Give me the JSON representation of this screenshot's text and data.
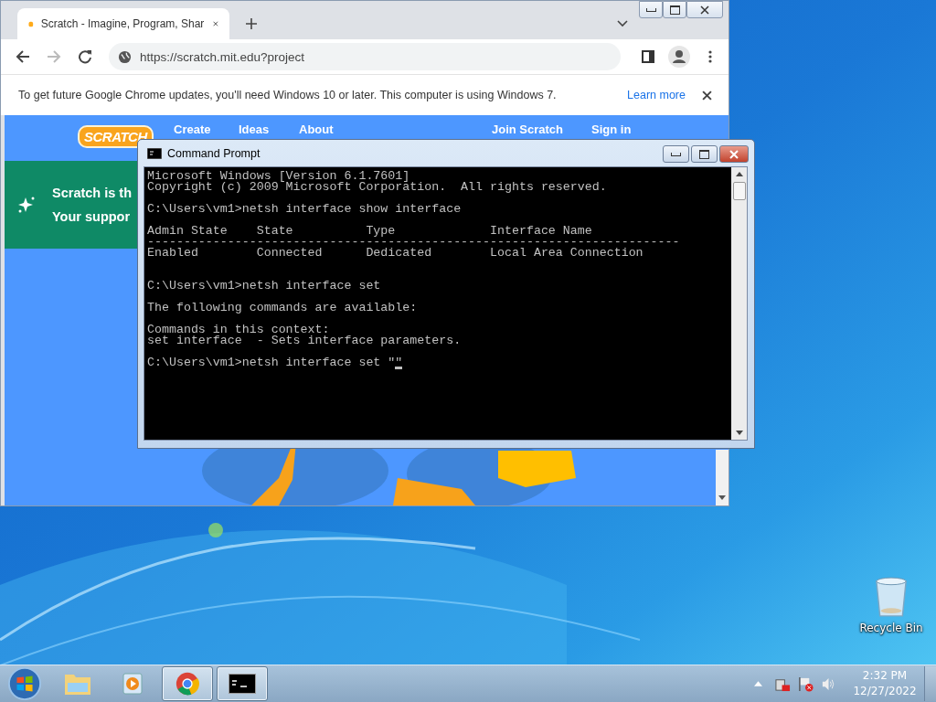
{
  "desktop": {
    "icons": [
      {
        "label": "Recycle Bin"
      }
    ]
  },
  "browser": {
    "tab": {
      "title": "Scratch - Imagine, Program, Shar"
    },
    "url": "https://scratch.mit.edu?project",
    "infobar": {
      "message": "To get future Google Chrome updates, you'll need Windows 10 or later. This computer is using Windows 7.",
      "link": "Learn more"
    },
    "page": {
      "logo": "SCRATCH",
      "nav": [
        {
          "label": "Create"
        },
        {
          "label": "Ideas"
        },
        {
          "label": "About"
        },
        {
          "label": "Join Scratch"
        },
        {
          "label": "Sign in"
        }
      ],
      "banner": [
        "Scratch is th",
        "Your suppor"
      ]
    }
  },
  "console": {
    "title": "Command Prompt",
    "blocks": [
      {
        "kind": "output",
        "lines": [
          "Microsoft Windows [Version 6.1.7601]",
          "Copyright (c) 2009 Microsoft Corporation.  All rights reserved."
        ]
      },
      {
        "kind": "output",
        "lines": [
          "C:\\Users\\vm1>netsh interface show interface"
        ]
      },
      {
        "kind": "table",
        "lines": [
          "Admin State    State          Type             Interface Name",
          "-------------------------------------------------------------------------",
          "Enabled        Connected      Dedicated        Local Area Connection"
        ]
      },
      {
        "kind": "output",
        "lines": [
          "C:\\Users\\vm1>netsh interface set"
        ]
      },
      {
        "kind": "output",
        "lines": [
          "The following commands are available:"
        ]
      },
      {
        "kind": "output",
        "lines": [
          "Commands in this context:",
          "set interface  - Sets interface parameters."
        ]
      },
      {
        "kind": "prompt",
        "lines": [
          "C:\\Users\\vm1>netsh interface set \"\""
        ]
      }
    ]
  },
  "taskbar": {
    "items": [
      {
        "kind": "explorer",
        "running": false
      },
      {
        "kind": "media",
        "running": false
      },
      {
        "kind": "chrome",
        "running": true
      },
      {
        "kind": "console",
        "running": true
      }
    ],
    "clock": {
      "time": "2:32 PM",
      "date": "12/27/2022"
    }
  }
}
